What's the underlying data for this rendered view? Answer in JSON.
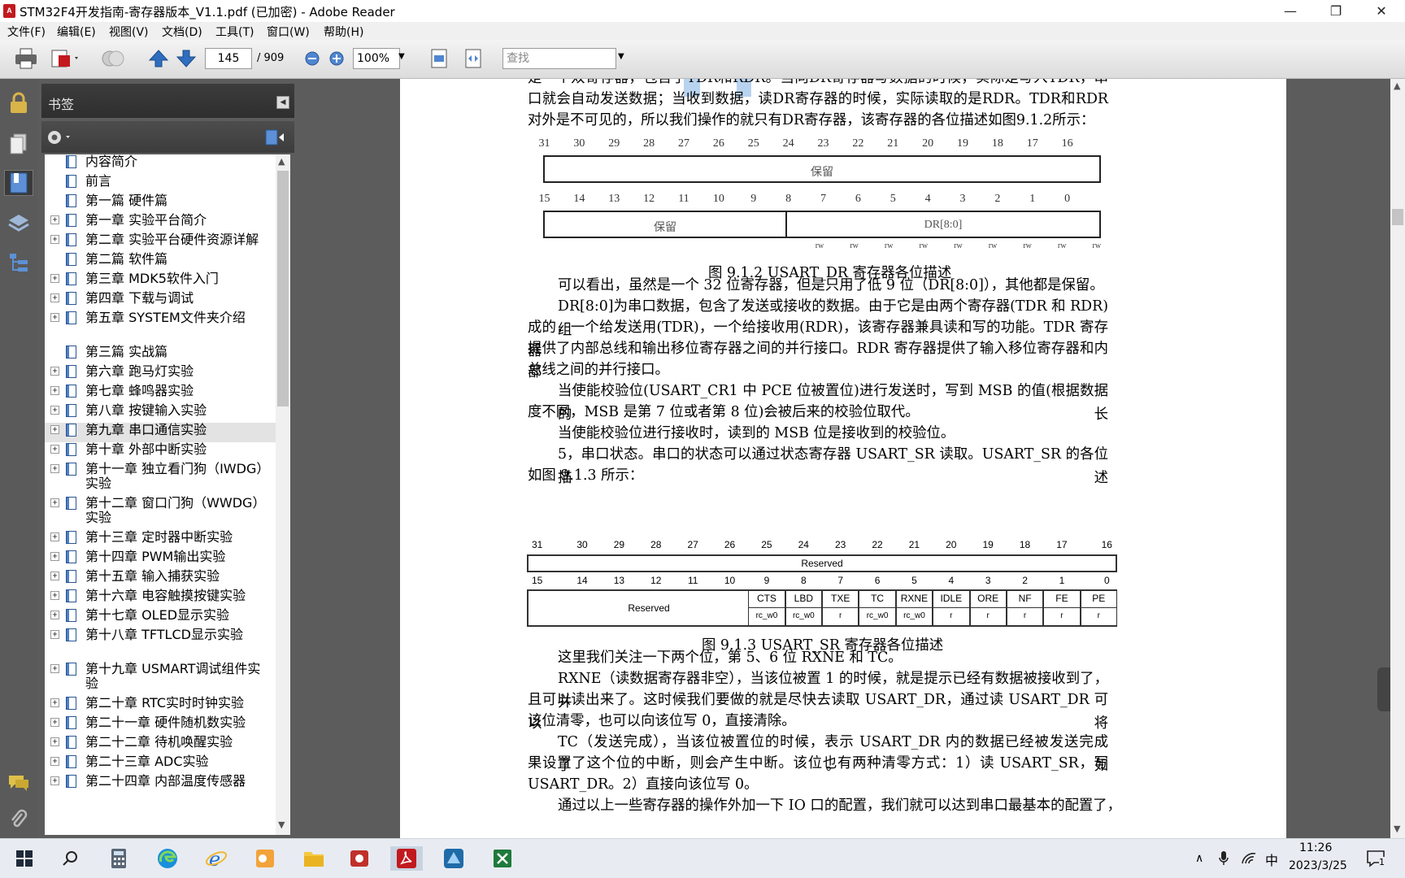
{
  "window": {
    "title": "STM32F4开发指南-寄存器版本_V1.1.pdf  (已加密)  - Adobe Reader",
    "minimize_icon": "—",
    "restore_icon": "❐",
    "close_icon": "✕"
  },
  "menu": {
    "items": [
      "文件(F)",
      "编辑(E)",
      "视图(V)",
      "文档(D)",
      "工具(T)",
      "窗口(W)",
      "帮助(H)"
    ],
    "doc_close": "×"
  },
  "toolbar": {
    "page_current": "145",
    "page_total": "/ 909",
    "zoom": "100%",
    "search_placeholder": "查找"
  },
  "sidebar": {
    "header": "书签",
    "bookmarks": [
      {
        "label": "内容简介",
        "expandable": false
      },
      {
        "label": "前言",
        "expandable": false
      },
      {
        "label": "第一篇 硬件篇",
        "expandable": false
      },
      {
        "label": "第一章 实验平台简介",
        "expandable": true
      },
      {
        "label": "第二章 实验平台硬件资源详解",
        "expandable": true
      },
      {
        "label": "第二篇 软件篇",
        "expandable": false
      },
      {
        "label": "第三章 MDK5软件入门",
        "expandable": true
      },
      {
        "label": "第四章 下载与调试",
        "expandable": true
      },
      {
        "label": "第五章 SYSTEM文件夹介绍",
        "expandable": true
      },
      {
        "label": "第三篇 实战篇",
        "expandable": false
      },
      {
        "label": "第六章 跑马灯实验",
        "expandable": true
      },
      {
        "label": "第七章 蜂鸣器实验",
        "expandable": true
      },
      {
        "label": "第八章 按键输入实验",
        "expandable": true
      },
      {
        "label": "第九章 串口通信实验",
        "expandable": true,
        "selected": true
      },
      {
        "label": "第十章 外部中断实验",
        "expandable": true
      },
      {
        "label": "第十一章 独立看门狗（IWDG）实验",
        "expandable": true
      },
      {
        "label": "第十二章 窗口门狗（WWDG）实验",
        "expandable": true
      },
      {
        "label": "第十三章 定时器中断实验",
        "expandable": true
      },
      {
        "label": "第十四章 PWM输出实验",
        "expandable": true
      },
      {
        "label": "第十五章 输入捕获实验",
        "expandable": true
      },
      {
        "label": "第十六章 电容触摸按键实验",
        "expandable": true
      },
      {
        "label": "第十七章 OLED显示实验",
        "expandable": true
      },
      {
        "label": "第十八章 TFTLCD显示实验",
        "expandable": true
      },
      {
        "label": "第十九章 USMART调试组件实验",
        "expandable": true
      },
      {
        "label": "第二十章 RTC实时时钟实验",
        "expandable": true
      },
      {
        "label": "第二十一章 硬件随机数实验",
        "expandable": true
      },
      {
        "label": "第二十二章 待机唤醒实验",
        "expandable": true
      },
      {
        "label": "第二十三章 ADC实验",
        "expandable": true
      },
      {
        "label": "第二十四章 内部温度传感器",
        "expandable": true
      }
    ]
  },
  "document": {
    "para1_lines": [
      "是一个双寄存器，包含了TDR和RDR。当向DR寄存器写数据的时候，实际是写入TDR，串",
      "口就会自动发送数据；当收到数据，读DR寄存器的时候，实际读取的是RDR。TDR和RDR",
      "对外是不可见的，所以我们操作的就只有DR寄存器，该寄存器的各位描述如图9.1.2所示："
    ],
    "dr_register": {
      "upper_bits": [
        "31",
        "30",
        "29",
        "28",
        "27",
        "26",
        "25",
        "24",
        "23",
        "22",
        "21",
        "20",
        "19",
        "18",
        "17",
        "16"
      ],
      "upper_label": "保留",
      "lower_bits": [
        "15",
        "14",
        "13",
        "12",
        "11",
        "10",
        "9",
        "8",
        "7",
        "6",
        "5",
        "4",
        "3",
        "2",
        "1",
        "0"
      ],
      "lower_reserved_label": "保留",
      "lower_field_label": "DR[8:0]",
      "access": [
        "rw",
        "rw",
        "rw",
        "rw",
        "rw",
        "rw",
        "rw",
        "rw",
        "rw"
      ]
    },
    "caption1": "图 9.1.2 USART_DR 寄存器各位描述",
    "para2": "可以看出，虽然是一个 32 位寄存器，但是只用了低 9 位（DR[8:0]），其他都是保留。",
    "para3_lines": [
      "DR[8:0]为串口数据，包含了发送或接收的数据。由于它是由两个寄存器(TDR 和 RDR)组",
      "成的，一个给发送用(TDR)，一个给接收用(RDR)，该寄存器兼具读和写的功能。TDR 寄存器",
      "提供了内部总线和输出移位寄存器之间的并行接口。RDR 寄存器提供了输入移位寄存器和内部",
      "总线之间的并行接口。"
    ],
    "para4_lines": [
      "当使能校验位(USART_CR1 中 PCE 位被置位)进行发送时，写到 MSB 的值(根据数据的长",
      "度不同，MSB 是第 7 位或者第 8 位)会被后来的校验位取代。"
    ],
    "para5": "当使能校验位进行接收时，读到的 MSB 位是接收到的校验位。",
    "para6_lines": [
      "5，串口状态。串口的状态可以通过状态寄存器 USART_SR 读取。USART_SR 的各位描述",
      "如图 9.1.3 所示："
    ],
    "sr_register": {
      "upper_bits": [
        "31",
        "30",
        "29",
        "28",
        "27",
        "26",
        "25",
        "24",
        "23",
        "22",
        "21",
        "20",
        "19",
        "18",
        "17",
        "16"
      ],
      "upper_label": "Reserved",
      "lower_bits": [
        "15",
        "14",
        "13",
        "12",
        "11",
        "10",
        "9",
        "8",
        "7",
        "6",
        "5",
        "4",
        "3",
        "2",
        "1",
        "0"
      ],
      "lower_reserved_label": "Reserved",
      "fields": [
        "CTS",
        "LBD",
        "TXE",
        "TC",
        "RXNE",
        "IDLE",
        "ORE",
        "NF",
        "FE",
        "PE"
      ],
      "access": [
        "rc_w0",
        "rc_w0",
        "r",
        "rc_w0",
        "rc_w0",
        "r",
        "r",
        "r",
        "r",
        "r"
      ]
    },
    "caption2": "图 9.1.3 USART_SR 寄存器各位描述",
    "para7": "这里我们关注一下两个位，第 5、6 位 RXNE 和 TC。",
    "para8_lines": [
      "RXNE（读数据寄存器非空），当该位被置 1 的时候，就是提示已经有数据被接收到了，并",
      "且可以读出来了。这时候我们要做的就是尽快去读取 USART_DR，通过读 USART_DR 可以将",
      "该位清零，也可以向该位写 0，直接清除。"
    ],
    "para9_lines": [
      "TC（发送完成），当该位被置位的时候，表示 USART_DR 内的数据已经被发送完成了。如",
      "果设置了这个位的中断，则会产生中断。该位也有两种清零方式：1）读 USART_SR，写",
      "USART_DR。2）直接向该位写 0。"
    ],
    "para10": "通过以上一些寄存器的操作外加一下 IO 口的配置，我们就可以达到串口最基本的配置了，"
  },
  "taskbar": {
    "time": "11:26",
    "date": "2023/3/25",
    "ime": "中",
    "notification_count": "1",
    "apps": [
      "start-icon",
      "search-icon",
      "calculator-icon",
      "edge-icon",
      "ie-icon",
      "outlook-icon",
      "file-explorer-icon",
      "video-recorder-icon",
      "adobe-reader-icon",
      "app-icon",
      "excel-like-icon"
    ]
  },
  "colors": {
    "dark_panel": "#5c5c5c",
    "rail": "#5a5a5a",
    "accent_blue": "#2a5592",
    "adobe_red": "#c2191f",
    "selection_highlight": "#b8d3f0"
  }
}
